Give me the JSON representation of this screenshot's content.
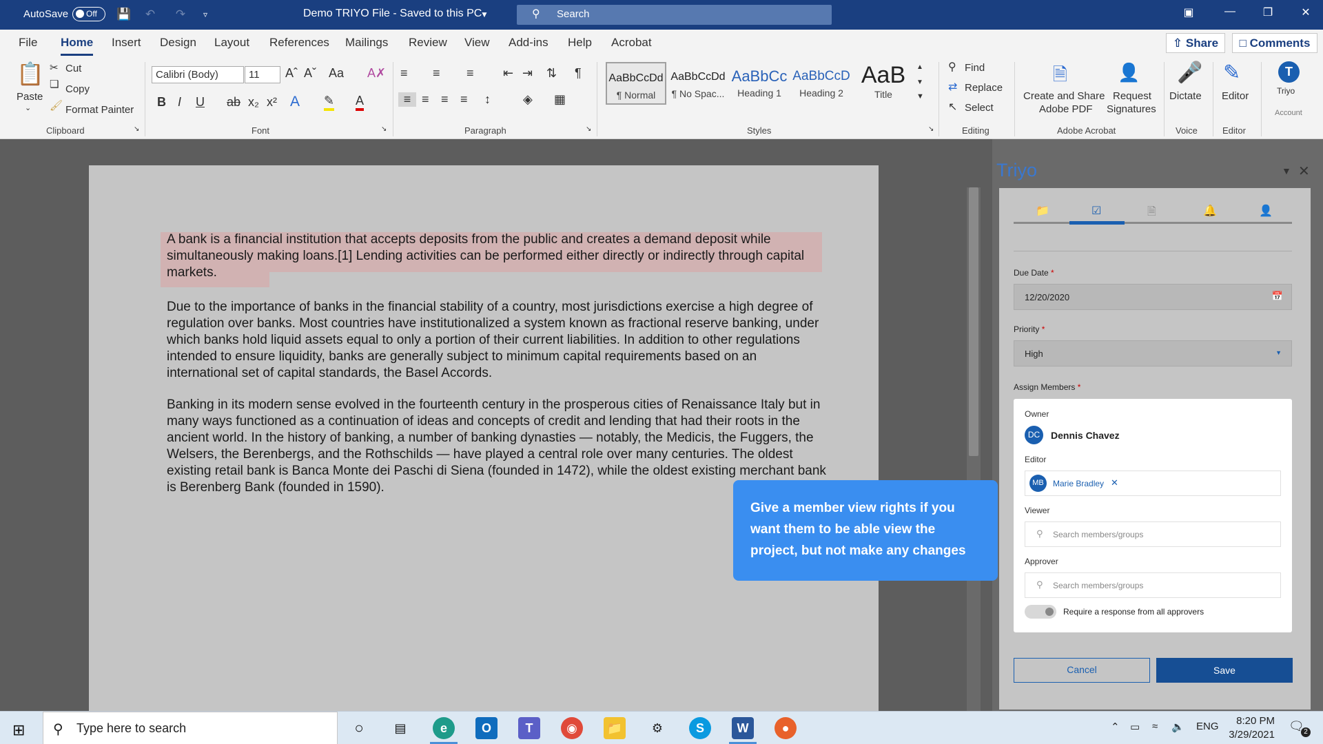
{
  "titlebar": {
    "autosave_label": "AutoSave",
    "autosave_state": "Off",
    "doc_title": "Demo TRIYO File  -  Saved to this PC",
    "search_placeholder": "Search"
  },
  "menu_tabs": [
    "File",
    "Home",
    "Insert",
    "Design",
    "Layout",
    "References",
    "Mailings",
    "Review",
    "View",
    "Add-ins",
    "Help",
    "Acrobat"
  ],
  "share_label": "Share",
  "comments_label": "Comments",
  "ribbon": {
    "clipboard": {
      "paste": "Paste",
      "cut": "Cut",
      "copy": "Copy",
      "format_painter": "Format Painter",
      "label": "Clipboard"
    },
    "font": {
      "font_name": "Calibri (Body)",
      "font_size": "11",
      "label": "Font"
    },
    "paragraph": {
      "label": "Paragraph"
    },
    "styles": {
      "label": "Styles",
      "items": [
        {
          "sample": "AaBbCcDd",
          "name": "¶ Normal"
        },
        {
          "sample": "AaBbCcDd",
          "name": "¶ No Spac..."
        },
        {
          "sample": "AaBbCc",
          "name": "Heading 1"
        },
        {
          "sample": "AaBbCcD",
          "name": "Heading 2"
        },
        {
          "sample": "AaB",
          "name": "Title"
        }
      ]
    },
    "editing": {
      "find": "Find",
      "replace": "Replace",
      "select": "Select",
      "label": "Editing"
    },
    "acrobat": {
      "create_share": "Create and Share",
      "adobe_pdf": "Adobe PDF",
      "request": "Request",
      "signatures": "Signatures",
      "label": "Adobe Acrobat"
    },
    "voice": {
      "dictate": "Dictate",
      "label": "Voice"
    },
    "editor": {
      "editor": "Editor",
      "label": "Editor"
    },
    "triyo": {
      "name": "Triyo",
      "label": "Account"
    }
  },
  "document": {
    "p1": "A bank is a financial institution that accepts deposits from the public and creates a demand deposit while simultaneously making loans.[1] Lending activities can be performed either directly or indirectly through capital markets.",
    "p2": "Due to the importance of banks in the financial stability of a country, most jurisdictions exercise a high degree of regulation over banks. Most countries have institutionalized a system known as fractional reserve banking, under which banks hold liquid assets equal to only a portion of their current liabilities. In addition to other regulations intended to ensure liquidity, banks are generally subject to minimum capital requirements based on an international set of capital standards, the Basel Accords.",
    "p3": "Banking in its modern sense evolved in the fourteenth century in the prosperous cities of Renaissance Italy but in many ways functioned as a continuation of ideas and concepts of credit and lending that had their roots in the ancient world. In the history of banking, a number of banking dynasties — notably, the Medicis, the Fuggers, the Welsers, the Berenbergs, and the Rothschilds — have played a central role over many centuries. The oldest existing retail bank is Banca Monte dei Paschi di Siena (founded in 1472), while the oldest existing merchant bank is Berenberg Bank (founded in 1590)."
  },
  "tooltip": "Give a member view rights if you want them to be able view the project, but not make any changes",
  "triyo_pane": {
    "title": "Triyo",
    "due_date_label": "Due Date",
    "due_date_value": "12/20/2020",
    "priority_label": "Priority",
    "priority_value": "High",
    "assign_label": "Assign Members",
    "owner_label": "Owner",
    "owner_initials": "DC",
    "owner_name": "Dennis Chavez",
    "editor_label": "Editor",
    "editor_initials": "MB",
    "editor_name": "Marie Bradley",
    "viewer_label": "Viewer",
    "viewer_placeholder": "Search members/groups",
    "approver_label": "Approver",
    "approver_placeholder": "Search members/groups",
    "require_label": "Require a response from all approvers",
    "cancel": "Cancel",
    "save": "Save"
  },
  "taskbar": {
    "search_placeholder": "Type here to search",
    "lang": "ENG",
    "time": "8:20 PM",
    "date": "3/29/2021",
    "notif_count": "2"
  },
  "colors": {
    "title_bar": "#1a3f80",
    "accent": "#1a5fb0",
    "tooltip": "#3a8ef0"
  }
}
